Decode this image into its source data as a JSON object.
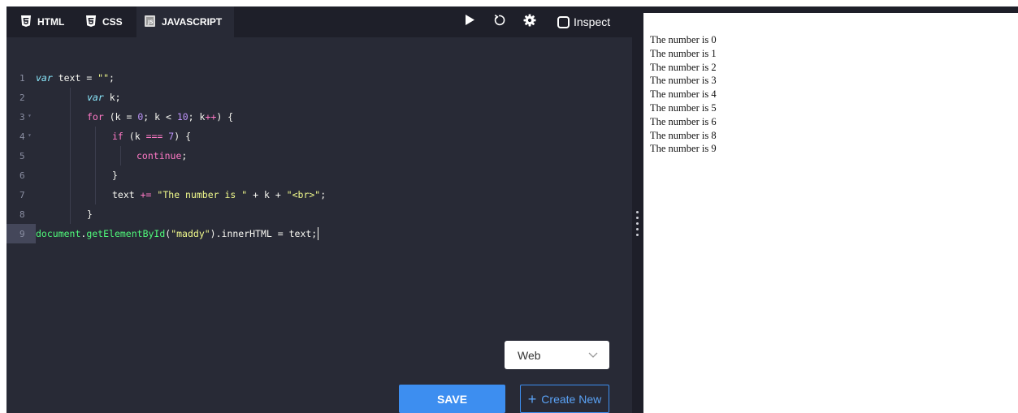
{
  "tabs": [
    {
      "label": "HTML",
      "icon": "html5-icon"
    },
    {
      "label": "CSS",
      "icon": "css3-icon"
    },
    {
      "label": "JAVASCRIPT",
      "icon": "js-file-icon",
      "active": true
    }
  ],
  "toolbar": {
    "run_icon": "play-icon",
    "reset_icon": "reset-icon",
    "settings_icon": "gear-icon",
    "inspect_label": "Inspect"
  },
  "editor": {
    "line_numbers": [
      "1",
      "2",
      "3",
      "4",
      "5",
      "6",
      "7",
      "8",
      "9"
    ],
    "active_line": 9,
    "line1": {
      "kw": "var",
      "rest": " text = ",
      "str": "\"\"",
      "end": ";"
    },
    "line2": {
      "kw": "var",
      "rest": " k;"
    },
    "line3": {
      "kw": "for",
      "a": " (k = ",
      "n1": "0",
      "b": "; k < ",
      "n2": "10",
      "c": "; k",
      "op": "++",
      "d": ") {"
    },
    "line4": {
      "kw": "if",
      "a": " (k ",
      "op": "===",
      "sp": " ",
      "n": "7",
      "b": ") {"
    },
    "line5": {
      "kw": "continue",
      "b": ";"
    },
    "line6": {
      "a": "}"
    },
    "line7": {
      "a": "text ",
      "op": "+=",
      "sp": " ",
      "s1": "\"The number is \"",
      "p1": " + k + ",
      "s2": "\"<br>\"",
      "e": ";"
    },
    "line8": {
      "a": "}"
    },
    "line9": {
      "fn1": "document",
      "dot": ".",
      "fn2": "getElementById",
      "a": "(",
      "s": "\"maddy\"",
      "b": ").innerHTML = text;"
    }
  },
  "controls": {
    "select_value": "Web",
    "save_label": "SAVE",
    "create_label": "Create New"
  },
  "colors": {
    "editor_bg": "#282a36",
    "toolbar_bg": "#1e1f29",
    "accent": "#3d8ef0",
    "keyword": "#ff79c6",
    "string": "#f1fa8c",
    "number": "#bd93f9",
    "function": "#50fa7b"
  },
  "output": {
    "lines": [
      "The number is 0",
      "The number is 1",
      "The number is 2",
      "The number is 3",
      "The number is 4",
      "The number is 5",
      "The number is 6",
      "The number is 8",
      "The number is 9"
    ]
  }
}
